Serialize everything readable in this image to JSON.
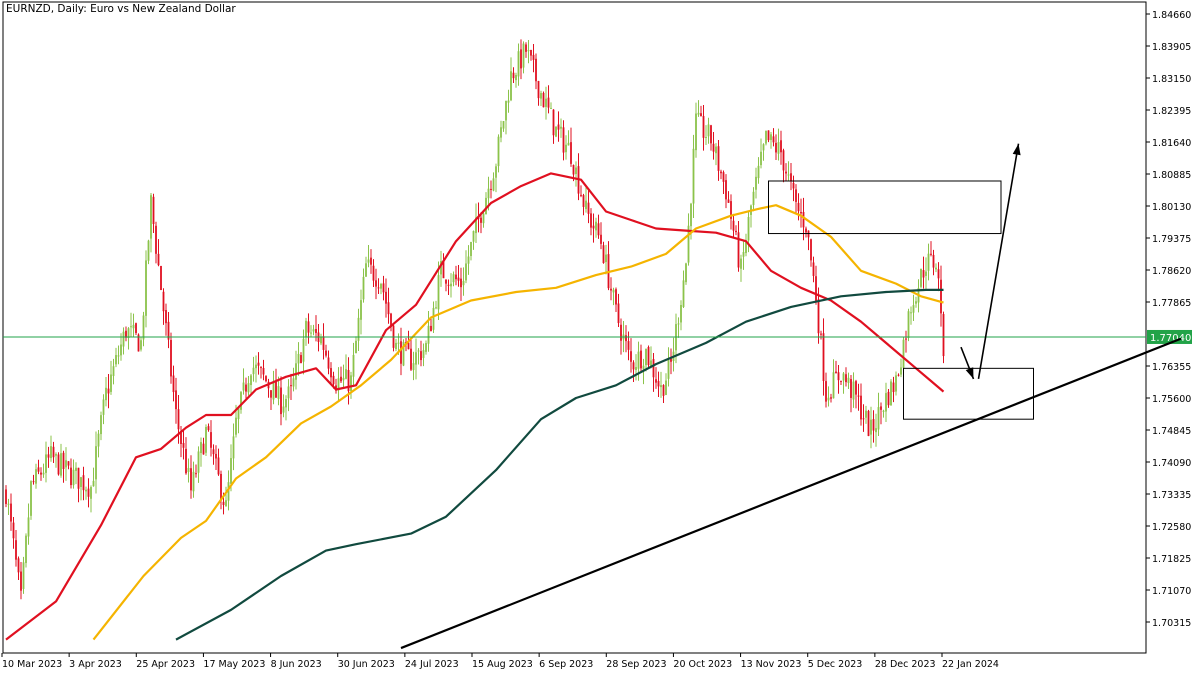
{
  "chart_title": "EURNZD, Daily:  Euro vs New Zealand Dollar",
  "current_price_label": "1.77040",
  "colors": {
    "bull": "#8bc34a",
    "bear": "#e01020",
    "ma_fast": "#e01020",
    "ma_mid": "#f5b400",
    "ma_slow": "#114a3f",
    "price_line": "#22a348",
    "price_tag": "#22a348",
    "drawing": "#000000"
  },
  "chart_data": {
    "type": "candlestick",
    "title": "EURNZD, Daily:  Euro vs New Zealand Dollar",
    "ylim": [
      1.697,
      1.8493
    ],
    "y_ticks": [
      "1.84660",
      "1.83905",
      "1.83150",
      "1.82395",
      "1.81640",
      "1.80885",
      "1.80130",
      "1.79375",
      "1.78620",
      "1.77865",
      "1.77040",
      "1.76355",
      "1.75600",
      "1.74845",
      "1.74090",
      "1.73335",
      "1.72580",
      "1.71825",
      "1.71070",
      "1.70315"
    ],
    "x_ticks": [
      "10 Mar 2023",
      "3 Apr 2023",
      "25 Apr 2023",
      "17 May 2023",
      "8 Jun 2023",
      "30 Jun 2023",
      "24 Jul 2023",
      "15 Aug 2023",
      "6 Sep 2023",
      "28 Sep 2023",
      "20 Oct 2023",
      "13 Nov 2023",
      "5 Dec 2023",
      "28 Dec 2023",
      "22 Jan 2024"
    ],
    "current_price": 1.7704,
    "close_trajectory": [
      [
        0,
        1.734
      ],
      [
        6,
        1.708
      ],
      [
        10,
        1.735
      ],
      [
        18,
        1.742
      ],
      [
        26,
        1.738
      ],
      [
        34,
        1.735
      ],
      [
        40,
        1.757
      ],
      [
        48,
        1.772
      ],
      [
        54,
        1.769
      ],
      [
        58,
        1.802
      ],
      [
        62,
        1.782
      ],
      [
        68,
        1.752
      ],
      [
        74,
        1.734
      ],
      [
        80,
        1.748
      ],
      [
        88,
        1.73
      ],
      [
        92,
        1.75
      ],
      [
        98,
        1.764
      ],
      [
        104,
        1.76
      ],
      [
        110,
        1.755
      ],
      [
        114,
        1.757
      ],
      [
        120,
        1.772
      ],
      [
        126,
        1.77
      ],
      [
        132,
        1.76
      ],
      [
        138,
        1.76
      ],
      [
        144,
        1.787
      ],
      [
        150,
        1.784
      ],
      [
        156,
        1.768
      ],
      [
        162,
        1.765
      ],
      [
        168,
        1.768
      ],
      [
        174,
        1.786
      ],
      [
        182,
        1.783
      ],
      [
        188,
        1.796
      ],
      [
        196,
        1.812
      ],
      [
        202,
        1.832
      ],
      [
        208,
        1.838
      ],
      [
        214,
        1.828
      ],
      [
        220,
        1.819
      ],
      [
        226,
        1.814
      ],
      [
        232,
        1.8
      ],
      [
        238,
        1.793
      ],
      [
        244,
        1.776
      ],
      [
        250,
        1.764
      ],
      [
        256,
        1.767
      ],
      [
        262,
        1.758
      ],
      [
        266,
        1.764
      ],
      [
        272,
        1.788
      ],
      [
        276,
        1.821
      ],
      [
        282,
        1.817
      ],
      [
        288,
        1.805
      ],
      [
        294,
        1.786
      ],
      [
        298,
        1.801
      ],
      [
        304,
        1.817
      ],
      [
        310,
        1.814
      ],
      [
        316,
        1.801
      ],
      [
        320,
        1.797
      ],
      [
        324,
        1.78
      ],
      [
        328,
        1.757
      ],
      [
        334,
        1.762
      ],
      [
        340,
        1.756
      ],
      [
        346,
        1.748
      ],
      [
        352,
        1.756
      ],
      [
        356,
        1.76
      ],
      [
        362,
        1.778
      ],
      [
        368,
        1.788
      ],
      [
        372,
        1.788
      ],
      [
        375,
        1.7725
      ]
    ],
    "moving_averages": [
      {
        "key": "ma_fast",
        "points": [
          [
            0,
            1.699
          ],
          [
            20,
            1.708
          ],
          [
            38,
            1.726
          ],
          [
            52,
            1.742
          ],
          [
            62,
            1.744
          ],
          [
            72,
            1.749
          ],
          [
            80,
            1.752
          ],
          [
            90,
            1.752
          ],
          [
            100,
            1.758
          ],
          [
            112,
            1.761
          ],
          [
            124,
            1.763
          ],
          [
            132,
            1.758
          ],
          [
            140,
            1.759
          ],
          [
            152,
            1.772
          ],
          [
            164,
            1.778
          ],
          [
            180,
            1.793
          ],
          [
            194,
            1.802
          ],
          [
            206,
            1.806
          ],
          [
            218,
            1.809
          ],
          [
            230,
            1.8075
          ],
          [
            240,
            1.8
          ],
          [
            250,
            1.798
          ],
          [
            260,
            1.796
          ],
          [
            272,
            1.7955
          ],
          [
            284,
            1.795
          ],
          [
            296,
            1.793
          ],
          [
            306,
            1.786
          ],
          [
            318,
            1.782
          ],
          [
            330,
            1.779
          ],
          [
            342,
            1.774
          ],
          [
            354,
            1.768
          ],
          [
            364,
            1.763
          ],
          [
            370,
            1.76
          ],
          [
            375,
            1.7575
          ]
        ]
      },
      {
        "key": "ma_mid",
        "points": [
          [
            35,
            1.699
          ],
          [
            55,
            1.714
          ],
          [
            70,
            1.723
          ],
          [
            80,
            1.727
          ],
          [
            92,
            1.737
          ],
          [
            104,
            1.742
          ],
          [
            118,
            1.75
          ],
          [
            130,
            1.754
          ],
          [
            142,
            1.759
          ],
          [
            154,
            1.765
          ],
          [
            170,
            1.775
          ],
          [
            186,
            1.779
          ],
          [
            204,
            1.781
          ],
          [
            220,
            1.782
          ],
          [
            236,
            1.785
          ],
          [
            250,
            1.787
          ],
          [
            264,
            1.79
          ],
          [
            276,
            1.796
          ],
          [
            290,
            1.799
          ],
          [
            300,
            1.8005
          ],
          [
            308,
            1.8015
          ],
          [
            318,
            1.799
          ],
          [
            330,
            1.794
          ],
          [
            342,
            1.786
          ],
          [
            356,
            1.783
          ],
          [
            366,
            1.78
          ],
          [
            375,
            1.7785
          ]
        ]
      },
      {
        "key": "ma_slow",
        "points": [
          [
            68,
            1.699
          ],
          [
            90,
            1.706
          ],
          [
            110,
            1.714
          ],
          [
            128,
            1.72
          ],
          [
            140,
            1.7215
          ],
          [
            162,
            1.724
          ],
          [
            176,
            1.728
          ],
          [
            196,
            1.739
          ],
          [
            214,
            1.751
          ],
          [
            228,
            1.756
          ],
          [
            244,
            1.759
          ],
          [
            260,
            1.764
          ],
          [
            280,
            1.769
          ],
          [
            296,
            1.774
          ],
          [
            314,
            1.7775
          ],
          [
            334,
            1.78
          ],
          [
            352,
            1.781
          ],
          [
            368,
            1.7815
          ],
          [
            375,
            1.7815
          ]
        ]
      }
    ],
    "trendline": [
      [
        158,
        1.697
      ],
      [
        470,
        1.77
      ]
    ],
    "rectangles": [
      {
        "x0": 305,
        "x1": 398,
        "y0": 1.7948,
        "y1": 1.8072
      },
      {
        "x0": 359,
        "x1": 411,
        "y0": 1.751,
        "y1": 1.763
      }
    ],
    "arrows": [
      {
        "from": [
          382,
          1.768
        ],
        "to": [
          387,
          1.7605
        ]
      },
      {
        "from": [
          389,
          1.7605
        ],
        "to": [
          405,
          1.816
        ]
      }
    ]
  }
}
